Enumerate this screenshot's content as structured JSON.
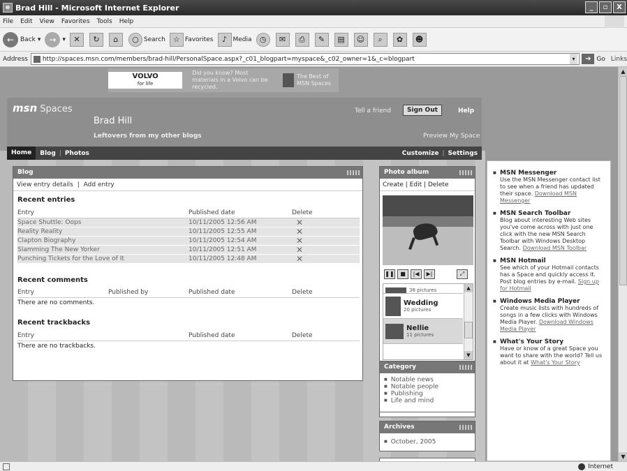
{
  "window": {
    "title": "Brad Hill - Microsoft Internet Explorer",
    "minimize": "_",
    "maximize": "▫",
    "close": "X"
  },
  "menu": [
    "File",
    "Edit",
    "View",
    "Favorites",
    "Tools",
    "Help"
  ],
  "toolbar": {
    "back": "Back",
    "search": "Search",
    "favorites": "Favorites",
    "media": "Media"
  },
  "address": {
    "label": "Address",
    "url": "http://spaces.msn.com/members/brad-hill/PersonalSpace.aspx?_c01_blogpart=myspace&_c02_owner=1&_c=blogpart",
    "go": "Go",
    "links": "Links"
  },
  "ad": {
    "brand": "VOLVO",
    "brand_sub": "for life",
    "text": "Did you know? Most materials in a Volvo can be recycled.",
    "best": "The Best of MSN Spaces"
  },
  "header": {
    "logo": "msn",
    "logo_suffix": "Spaces",
    "owner": "Brad Hill",
    "tagline": "Leftovers from my other blogs",
    "tell_friend": "Tell a friend",
    "sign_out": "Sign Out",
    "help": "Help",
    "preview": "Preview My Space"
  },
  "nav": {
    "home": "Home",
    "blog": "Blog",
    "photos": "Photos",
    "customize": "Customize",
    "settings": "Settings",
    "sep": "|"
  },
  "blog": {
    "title": "Blog",
    "view_details": "View entry details",
    "add_entry": "Add entry",
    "recent_entries": "Recent entries",
    "col_entry": "Entry",
    "col_published": "Published date",
    "col_delete": "Delete",
    "delete_glyph": "✕",
    "entries": [
      {
        "title": "Space Shuttle: Oops",
        "date": "10/11/2005 12:56 AM"
      },
      {
        "title": "Reality Reality",
        "date": "10/11/2005 12:55 AM"
      },
      {
        "title": "Clapton Biography",
        "date": "10/11/2005 12:54 AM"
      },
      {
        "title": "Slamming The New Yorker",
        "date": "10/11/2005 12:51 AM"
      },
      {
        "title": "Punching Tickets for the Love of It",
        "date": "10/11/2005 12:48 AM"
      }
    ],
    "recent_comments": "Recent comments",
    "col_published_by": "Published by",
    "no_comments": "There are no comments.",
    "recent_trackbacks": "Recent trackbacks",
    "no_trackbacks": "There are no trackbacks."
  },
  "photo_album": {
    "title": "Photo album",
    "create": "Create",
    "edit": "Edit",
    "delete": "Delete",
    "albums": [
      {
        "name": "",
        "count": "38 pictures"
      },
      {
        "name": "Wedding",
        "count": "20 pictures"
      },
      {
        "name": "Nellie",
        "count": "11 pictures"
      }
    ]
  },
  "category": {
    "title": "Category",
    "items": [
      "Notable news",
      "Notable people",
      "Publishing",
      "Life and mind"
    ]
  },
  "archives": {
    "title": "Archives",
    "items": [
      "October, 2005"
    ]
  },
  "sidebar": {
    "items": [
      {
        "title": "MSN Messenger",
        "text": "Use the MSN Messenger contact list to see when a friend has updated their space.",
        "link": "Download MSN Messenger"
      },
      {
        "title": "MSN Search Toolbar",
        "text": "Blog about interesting Web sites you've come across with just one click with the new MSN Search Toolbar with Windows Desktop Search.",
        "link": "Download MSN Toolbar"
      },
      {
        "title": "MSN Hotmail",
        "text": "See which of your Hotmail contacts has a Space and quickly access it. Post blog entries by e-mail.",
        "link": "Sign up for Hotmail"
      },
      {
        "title": "Windows Media Player",
        "text": "Create music lists with hundreds of songs in a few clicks with Windows Media Player.",
        "link": "Download Windows Media Player"
      },
      {
        "title": "What's Your Story",
        "text": "Have or know of a great Space you want to share with the world? Tell us about it at",
        "link": "What's Your Story"
      }
    ]
  },
  "status": {
    "zone": "Internet"
  }
}
